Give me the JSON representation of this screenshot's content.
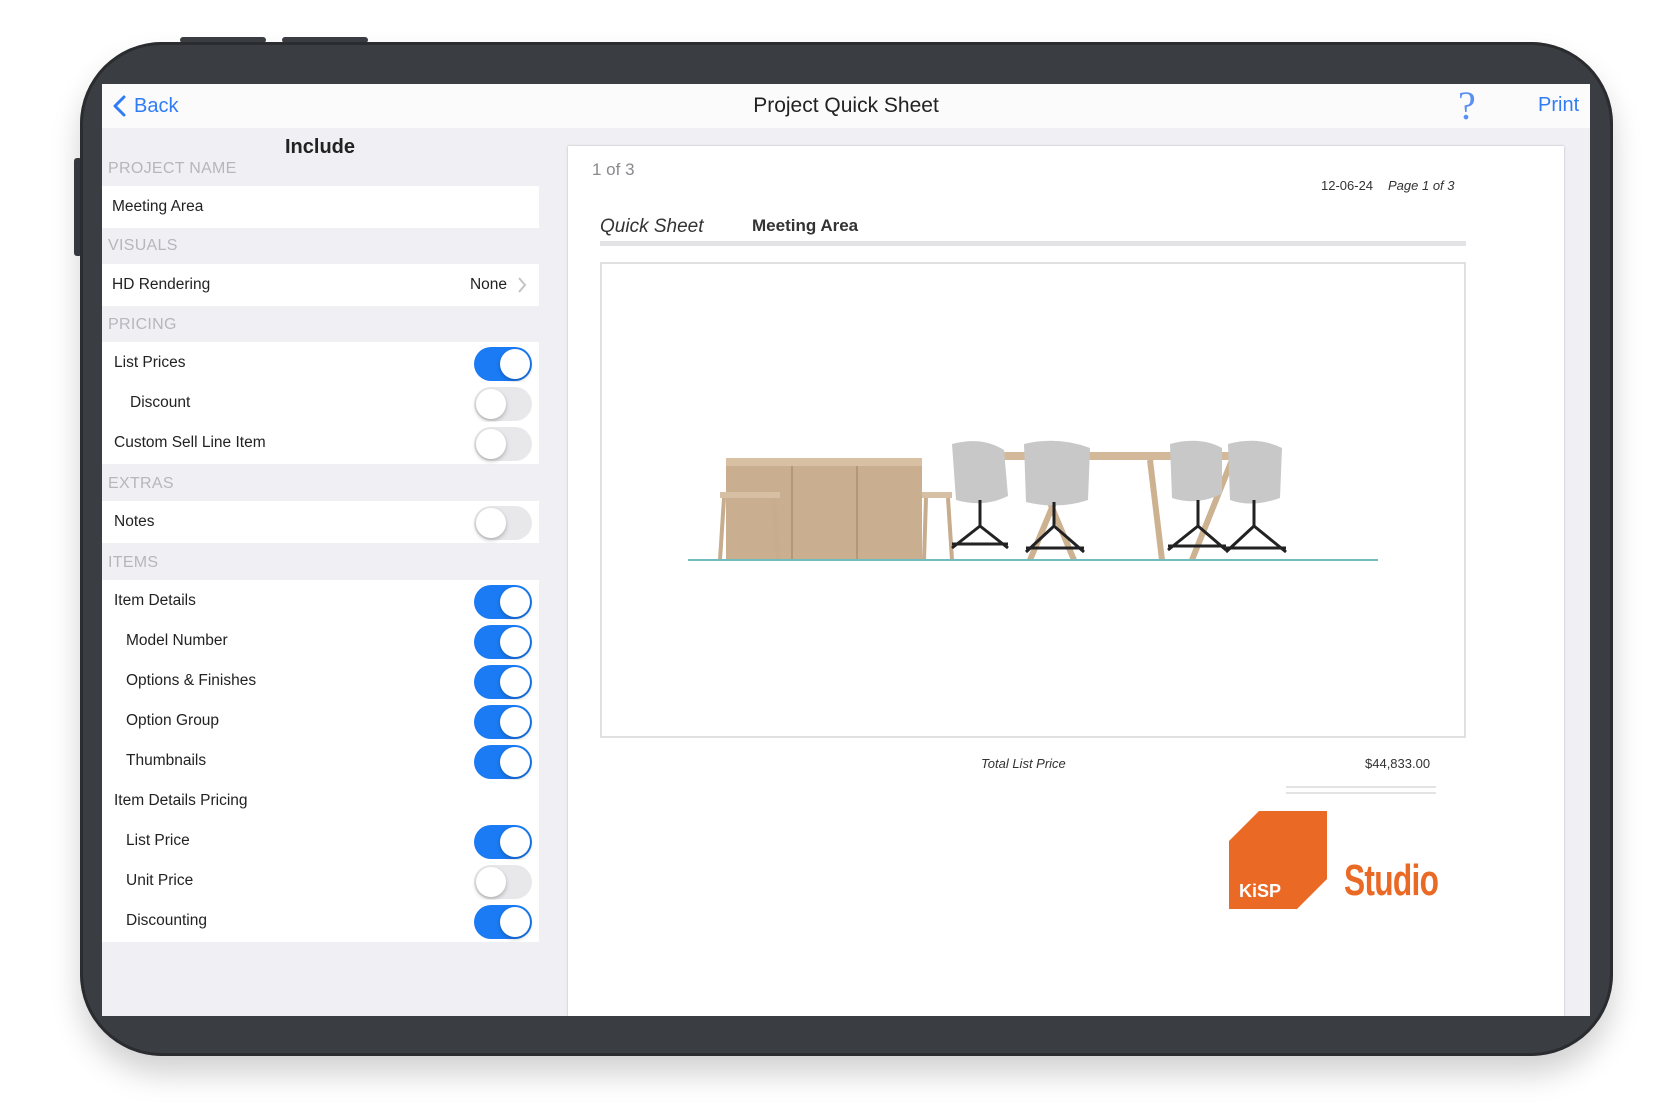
{
  "nav": {
    "back_label": "Back",
    "title": "Project Quick Sheet",
    "help_label": "?",
    "print_label": "Print"
  },
  "settings": {
    "header": "Include",
    "sections": {
      "project_name": "PROJECT NAME",
      "visuals": "VISUALS",
      "pricing": "PRICING",
      "extras": "EXTRAS",
      "items": "ITEMS"
    },
    "project_name_value": "Meeting Area",
    "hd_rendering": {
      "label": "HD Rendering",
      "value": "None"
    },
    "rows": [
      {
        "label": "List Prices",
        "on": true
      },
      {
        "label": "Discount",
        "on": false
      },
      {
        "label": "Custom Sell Line Item",
        "on": false
      },
      {
        "label": "Notes",
        "on": false
      },
      {
        "label": "Item Details",
        "on": true
      },
      {
        "label": "Model Number",
        "on": true
      },
      {
        "label": "Options & Finishes",
        "on": true
      },
      {
        "label": "Option Group",
        "on": true
      },
      {
        "label": "Thumbnails",
        "on": true
      },
      {
        "label": "Item Details Pricing"
      },
      {
        "label": "List Price",
        "on": true
      },
      {
        "label": "Unit Price",
        "on": false
      },
      {
        "label": "Discounting",
        "on": true
      }
    ]
  },
  "preview": {
    "page_indicator": "1 of 3",
    "date": "12-06-24",
    "page_of": "Page 1 of 3",
    "sheet_title": "Quick Sheet",
    "area_name": "Meeting Area",
    "total_label": "Total List Price",
    "total_value": "$44,833.00",
    "logo_text": "KiSP",
    "studio_text": "Studio",
    "colors": {
      "accent": "#1a7bf5",
      "brand_orange": "#ea6a25"
    }
  }
}
